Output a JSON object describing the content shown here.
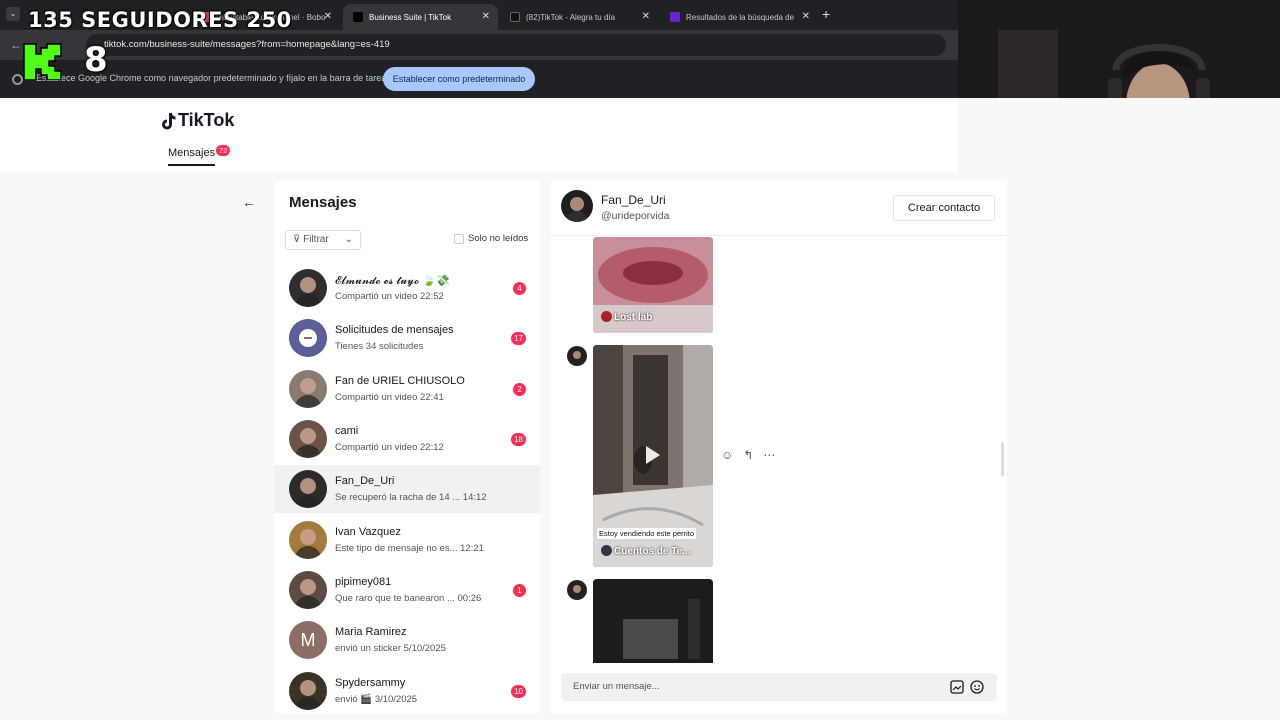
{
  "browser": {
    "tabs": [
      {
        "title": "Habilitable   Admin panel ·  Bobo",
        "active": false
      },
      {
        "title": "Business Suite | TikTok",
        "active": true
      },
      {
        "title": "(82)TikTok - Alegra tu día",
        "active": false
      },
      {
        "title": "Resultados de la búsqueda de",
        "active": false
      }
    ],
    "url": "tiktok.com/business-suite/messages?from=homepage&lang=es-419",
    "infobar_message": "Establece Google Chrome como navegador predeterminado y fíjalo en la barra de tareas",
    "set_default_label": "Establecer como predeterminado"
  },
  "overlay": {
    "followers_text": "135  SEGUIDORES  250",
    "big_number": "8"
  },
  "tiktok": {
    "logo_text": "TikTok",
    "nav_messages": "Mensajes",
    "nav_badge": "72"
  },
  "inbox": {
    "title": "Mensajes",
    "filter_label": "Filtrar",
    "unread_only_label": "Solo no leídos",
    "conversations": [
      {
        "name": "𝓔𝓵𝓶𝓾𝓷𝓭𝓸 𝓮𝓼 𝓽𝓾𝔂𝓸 🍃💸",
        "sub": "Compartió un video 22:52",
        "badge": "4",
        "avatar_color": "#2e2e2e"
      },
      {
        "name": "Solicitudes de mensajes",
        "sub": "Tienes 34 solicitudes",
        "badge": "17",
        "avatar_color": "#5b5f97"
      },
      {
        "name": "Fan de URIEL CHIUSOLO",
        "sub": "Compartió un video 22:41",
        "badge": "2",
        "avatar_color": "#8a7a70"
      },
      {
        "name": "cami",
        "sub": "Compartió un video 22:12",
        "badge": "18",
        "avatar_color": "#6d5347"
      },
      {
        "name": "Fan_De_Uri",
        "sub": "Se recuperó la racha de 14 ...  14:12",
        "badge": "",
        "avatar_color": "#2b2b2b"
      },
      {
        "name": "Ivan Vazquez",
        "sub": "Este tipo de mensaje no es...  12:21",
        "badge": "",
        "avatar_color": "#a47b3e"
      },
      {
        "name": "pipimey081",
        "sub": "Que raro que te banearon ...  00:26",
        "badge": "1",
        "avatar_color": "#5c4a43"
      },
      {
        "name": "Maria Ramirez",
        "sub": "envió un sticker 5/10/2025",
        "badge": "",
        "avatar_color": "#8b6f66",
        "initial": "M"
      },
      {
        "name": "Spydersammy",
        "sub": "envió 🎬 3/10/2025",
        "badge": "10",
        "avatar_color": "#3a3226"
      }
    ]
  },
  "chat": {
    "name": "Fan_De_Uri",
    "handle": "@urideporvida",
    "create_contact": "Crear contacto",
    "videos": [
      {
        "caption": "Lost lab"
      },
      {
        "caption": "Cuentos de Te...",
        "overlay_text": "Estoy vendiendo este perrito"
      },
      {
        "caption": ""
      }
    ],
    "composer_placeholder": "Enviar un mensaje..."
  }
}
